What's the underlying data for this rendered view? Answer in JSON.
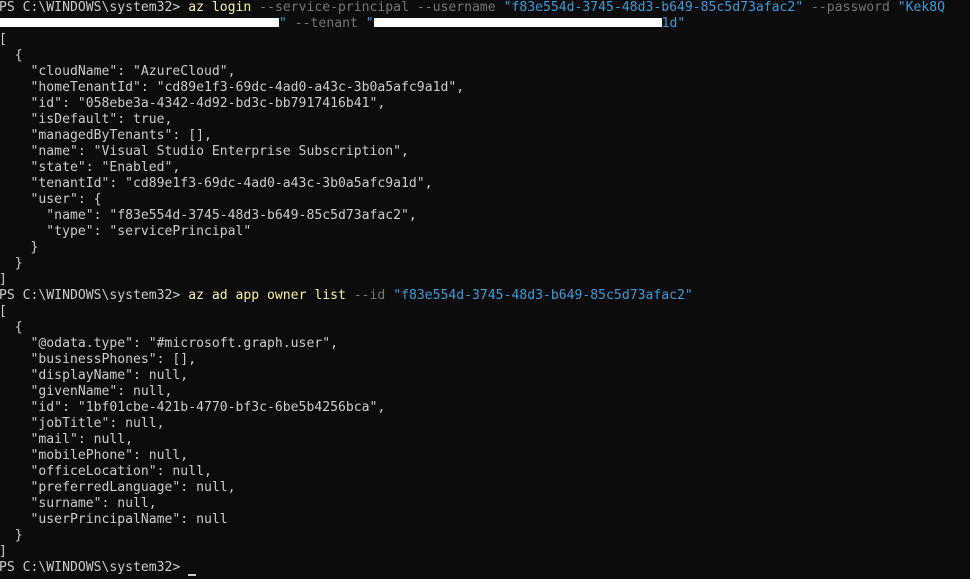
{
  "prompt": "PS C:\\WINDOWS\\system32> ",
  "cmd1": {
    "name": "az login",
    "flag_sp": "--service-principal",
    "flag_user": "--username",
    "username": "\"f83e554d-3745-48d3-b649-85c5d73afac2\"",
    "flag_pass": "--password",
    "password_start": "\"Kek8Q",
    "password_cont": "\"",
    "flag_tenant": "--tenant",
    "tenant_start": "\"",
    "tenant_end": "1d\""
  },
  "out1": [
    "[",
    "  {",
    "    \"cloudName\": \"AzureCloud\",",
    "    \"homeTenantId\": \"cd89e1f3-69dc-4ad0-a43c-3b0a5afc9a1d\",",
    "    \"id\": \"058ebe3a-4342-4d92-bd3c-bb7917416b41\",",
    "    \"isDefault\": true,",
    "    \"managedByTenants\": [],",
    "    \"name\": \"Visual Studio Enterprise Subscription\",",
    "    \"state\": \"Enabled\",",
    "    \"tenantId\": \"cd89e1f3-69dc-4ad0-a43c-3b0a5afc9a1d\",",
    "    \"user\": {",
    "      \"name\": \"f83e554d-3745-48d3-b649-85c5d73afac2\",",
    "      \"type\": \"servicePrincipal\"",
    "    }",
    "  }",
    "]"
  ],
  "cmd2": {
    "name": "az ad app owner list",
    "flag_id": "--id",
    "id": "\"f83e554d-3745-48d3-b649-85c5d73afac2\""
  },
  "out2": [
    "[",
    "  {",
    "    \"@odata.type\": \"#microsoft.graph.user\",",
    "    \"businessPhones\": [],",
    "    \"displayName\": null,",
    "    \"givenName\": null,",
    "    \"id\": \"1bf01cbe-421b-4770-bf3c-6be5b4256bca\",",
    "    \"jobTitle\": null,",
    "    \"mail\": null,",
    "    \"mobilePhone\": null,",
    "    \"officeLocation\": null,",
    "    \"preferredLanguage\": null,",
    "    \"surname\": null,",
    "    \"userPrincipalName\": null",
    "  }",
    "]"
  ]
}
